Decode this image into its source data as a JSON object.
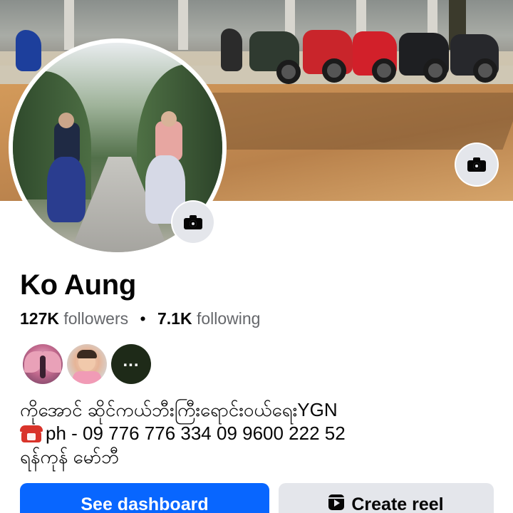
{
  "profile": {
    "name": "Ko Aung",
    "followers_count": "127K",
    "followers_label": "followers",
    "separator": "•",
    "following_count": "7.1K",
    "following_label": "following"
  },
  "friends_preview": {
    "more_label": "..."
  },
  "bio": {
    "line1": "ကိုအောင် ဆိုင်ကယ်ဘီးကြီးရောင်းဝယ်ရေးYGN",
    "line2": "ph - 09 776 776 334 09 9600 222 52",
    "line3": "ရန်ကုန် မော်ဘီ",
    "phone_icon": "telephone-icon"
  },
  "actions": {
    "primary_label": "See dashboard",
    "secondary_label": "Create reel"
  },
  "colors": {
    "primary": "#0866ff",
    "secondary_bg": "#e4e6eb",
    "muted_text": "#65676b"
  }
}
